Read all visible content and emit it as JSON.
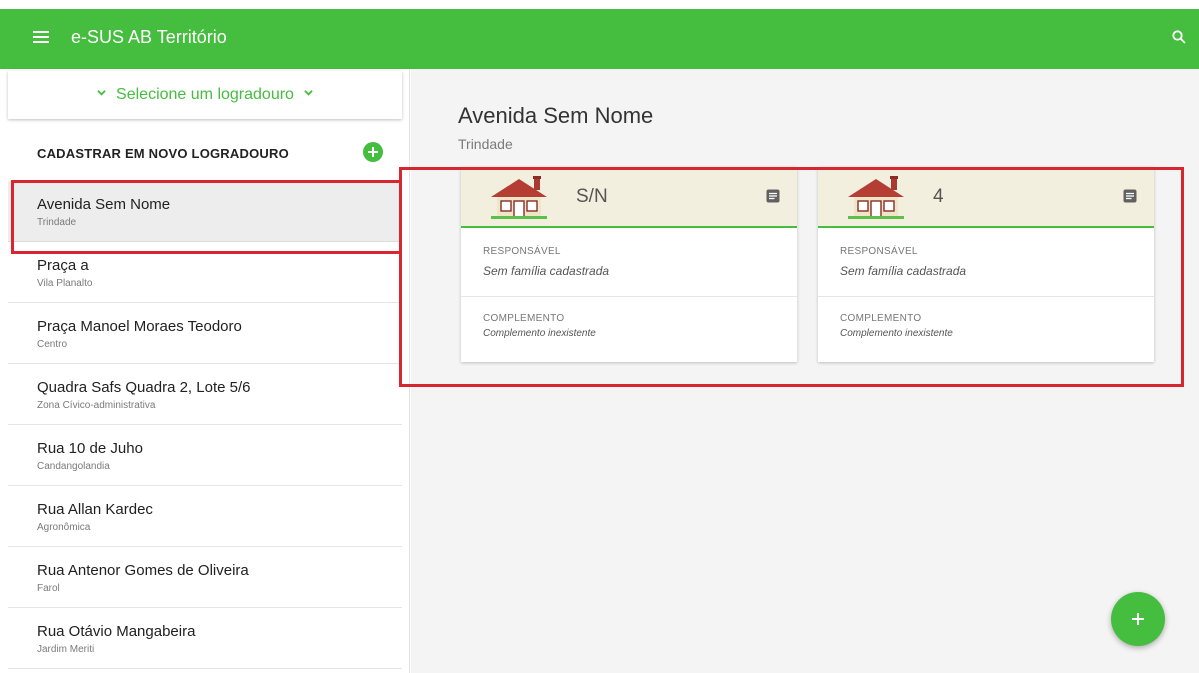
{
  "app_bar": {
    "title": "e-SUS AB Território",
    "menu_icon": "menu-icon",
    "search_icon": "search-icon",
    "color": "#45bd3f"
  },
  "sidebar": {
    "selector_label": "Selecione um logradouro",
    "new_address_label": "CADASTRAR EM NOVO LOGRADOURO",
    "items": [
      {
        "name": "Avenida Sem Nome",
        "neighborhood": "Trindade",
        "selected": true
      },
      {
        "name": "Praça a",
        "neighborhood": "Vila Planalto"
      },
      {
        "name": "Praça Manoel Moraes Teodoro",
        "neighborhood": "Centro"
      },
      {
        "name": "Quadra Safs Quadra 2, Lote 5/6",
        "neighborhood": "Zona Cívico-administrativa"
      },
      {
        "name": "Rua 10 de Juho",
        "neighborhood": "Candangolandia"
      },
      {
        "name": "Rua Allan Kardec",
        "neighborhood": "Agronômica"
      },
      {
        "name": "Rua Antenor Gomes de Oliveira",
        "neighborhood": "Farol"
      },
      {
        "name": "Rua Otávio Mangabeira",
        "neighborhood": "Jardim Meriti"
      }
    ]
  },
  "main": {
    "title": "Avenida Sem Nome",
    "subtitle": "Trindade",
    "cards": [
      {
        "number": "S/N",
        "responsible_label": "RESPONSÁVEL",
        "responsible_value": "Sem família cadastrada",
        "complement_label": "COMPLEMENTO",
        "complement_value": "Complemento inexistente"
      },
      {
        "number": "4",
        "responsible_label": "RESPONSÁVEL",
        "responsible_value": "Sem família cadastrada",
        "complement_label": "COMPLEMENTO",
        "complement_value": "Complemento inexistente"
      }
    ]
  },
  "fab_icon": "add-icon",
  "highlight_color": "#d7262f"
}
